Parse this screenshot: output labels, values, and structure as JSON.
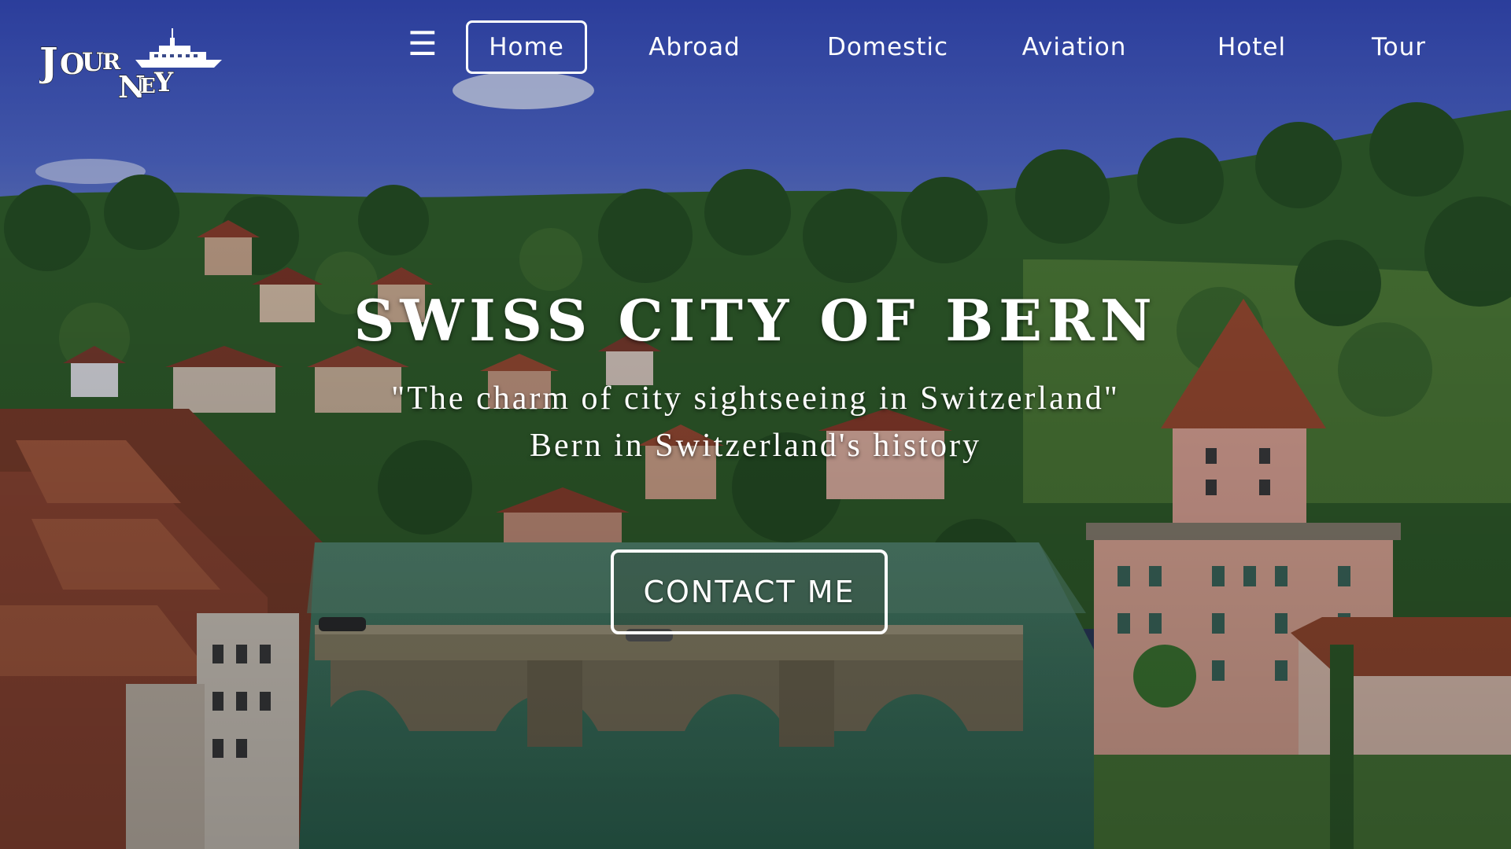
{
  "brand": {
    "logo_text": "JOURNEY"
  },
  "nav": {
    "menu_icon": "☰",
    "items": [
      {
        "label": "Home",
        "active": true
      },
      {
        "label": "Abroad",
        "active": false
      },
      {
        "label": "Domestic",
        "active": false
      },
      {
        "label": "Aviation",
        "active": false
      },
      {
        "label": "Hotel",
        "active": false
      },
      {
        "label": "Tour",
        "active": false
      }
    ]
  },
  "hero": {
    "title": "SWISS CITY OF BERN",
    "subtitle_line1": "\"The charm of city sightseeing in Switzerland\"",
    "subtitle_line2": "Bern in Switzerland's history",
    "cta_label": "CONTACT ME"
  },
  "icons": {
    "menu": "hamburger-menu-icon",
    "logo_ship": "ship-icon"
  },
  "colors": {
    "sky": "#3d55c4",
    "foliage": "#2f5a26",
    "roof": "#9a4a30",
    "river": "#3f7a62",
    "text": "#ffffff"
  }
}
